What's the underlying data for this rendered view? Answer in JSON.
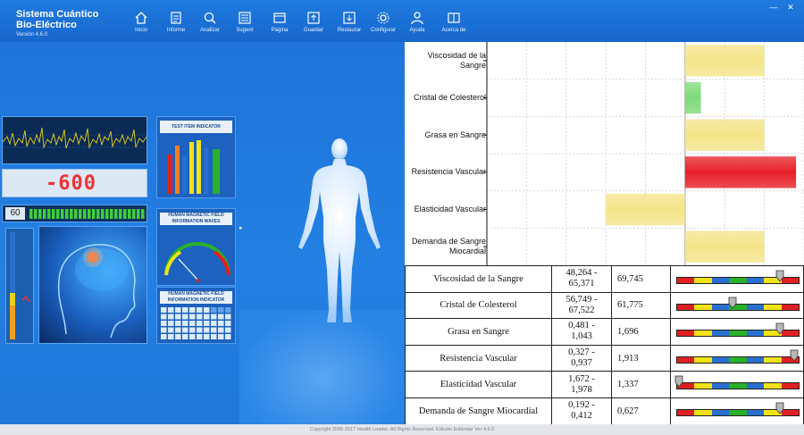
{
  "app": {
    "title_line1": "Sistema Cuántico",
    "title_line2": "Bio-Eléctrico",
    "version": "Versión 4.6.0"
  },
  "nav": [
    {
      "label": "Inicio",
      "icon": "home-icon"
    },
    {
      "label": "Informe",
      "icon": "report-icon"
    },
    {
      "label": "Analizar",
      "icon": "analyze-icon"
    },
    {
      "label": "Sugerir",
      "icon": "suggest-icon"
    },
    {
      "label": "Página",
      "icon": "page-icon"
    },
    {
      "label": "Guardar",
      "icon": "save-icon"
    },
    {
      "label": "Restaurar",
      "icon": "restore-icon"
    },
    {
      "label": "Configurar",
      "icon": "settings-icon"
    },
    {
      "label": "Ayuda",
      "icon": "help-icon"
    },
    {
      "label": "Acerca de",
      "icon": "about-icon"
    }
  ],
  "window": {
    "minimize": "—",
    "close": "✕"
  },
  "visual": {
    "counter_value": "-600",
    "pulse_value": "60",
    "test_indicator": "TEST ITEM INDICATOR",
    "waves_label": "HUMAN MAGNETIC FIELD INFORMATION WAVES",
    "info_label": "HUMAN MAGNETIC FIELD INFORMATION INDICATOR"
  },
  "chart_data": {
    "type": "bar",
    "orientation": "horizontal",
    "categories": [
      "Viscosidad de la Sangre",
      "Cristal de Colesterol",
      "Grasa en Sangre",
      "Resistencia Vascular",
      "Elasticidad Vascular",
      "Demanda de Sangre Miocardial"
    ],
    "values": [
      2,
      0.4,
      2,
      2.8,
      -2,
      2
    ],
    "colors": [
      "#F4E58A",
      "#7EDB7A",
      "#F4E58A",
      "#E8202A",
      "#F4E58A",
      "#F4E58A"
    ],
    "xlim": [
      -5,
      3
    ],
    "grid": true
  },
  "table": {
    "rows": [
      {
        "name": "Viscosidad de la Sangre",
        "range_lo": "48,264 -",
        "range_hi": "65,371",
        "value": "69,745",
        "marker": 0.84
      },
      {
        "name": "Cristal de Colesterol",
        "range_lo": "56,749 -",
        "range_hi": "67,522",
        "value": "61,775",
        "marker": 0.46
      },
      {
        "name": "Grasa en Sangre",
        "range_lo": "0,481 -",
        "range_hi": "1,043",
        "value": "1,696",
        "marker": 0.84
      },
      {
        "name": "Resistencia Vascular",
        "range_lo": "0,327 -",
        "range_hi": "0,937",
        "value": "1,913",
        "marker": 0.96
      },
      {
        "name": "Elasticidad Vascular",
        "range_lo": "1,672 -",
        "range_hi": "1,978",
        "value": "1,337",
        "marker": 0.02
      },
      {
        "name": "Demanda de Sangre Miocardial",
        "range_lo": "0,192 -",
        "range_hi": "0,412",
        "value": "0,627",
        "marker": 0.84
      }
    ],
    "scale_colors": [
      "#E02020",
      "#F2E21A",
      "#2A6FD0",
      "#2AB02A",
      "#2A6FD0",
      "#F2E21A",
      "#E02020"
    ]
  },
  "footer": "Copyright 2006-2017 Health Leader. All Rights Reserved.  Edición Estándar Ver 4.6.0"
}
